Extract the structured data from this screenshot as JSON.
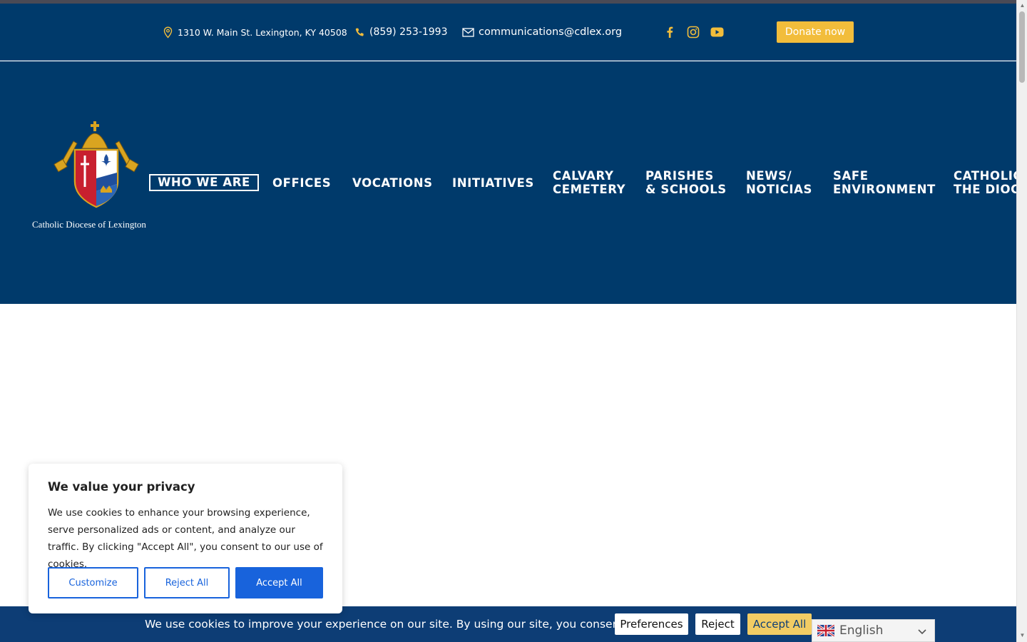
{
  "topbar": {
    "address": "1310 W. Main St. Lexington, KY 40508",
    "phone": "(859) 253-1993",
    "email": "communications@cdlex.org",
    "donate_label": "Donate now",
    "social_icons": [
      "facebook-icon",
      "instagram-icon",
      "youtube-icon"
    ]
  },
  "header": {
    "logo_text": "Catholic Diocese of Lexington",
    "nav": [
      {
        "line1": "WHO WE ARE",
        "line2": ""
      },
      {
        "line1": "OFFICES",
        "line2": ""
      },
      {
        "line1": "VOCATIONS",
        "line2": ""
      },
      {
        "line1": "INITIATIVES",
        "line2": ""
      },
      {
        "line1": "CALVARY",
        "line2": "CEMETERY"
      },
      {
        "line1": "PARISHES",
        "line2": "& SCHOOLS"
      },
      {
        "line1": "NEWS/",
        "line2": "NOTICIAS"
      },
      {
        "line1": "SAFE",
        "line2": "ENVIRONMENT"
      },
      {
        "line1": "CATHOLIC",
        "line2": "THE DIOCE"
      }
    ]
  },
  "cookie_modal": {
    "title": "We value your privacy",
    "text": "We use cookies to enhance your browsing experience, serve personalized ads or content, and analyze our traffic. By clicking \"Accept All\", you consent to our use of cookies.",
    "customize_label": "Customize",
    "reject_label": "Reject All",
    "accept_label": "Accept All"
  },
  "cookie_bar": {
    "text": "We use cookies to improve your experience on our site. By using our site, you consent to cookies.",
    "preferences_label": "Preferences",
    "reject_label": "Reject",
    "accept_label": "Accept All"
  },
  "language": {
    "selected": "English"
  },
  "colors": {
    "brand_navy": "#003a6b",
    "accent_gold": "#f2bd3b",
    "cookie_blue": "#1863dc"
  }
}
